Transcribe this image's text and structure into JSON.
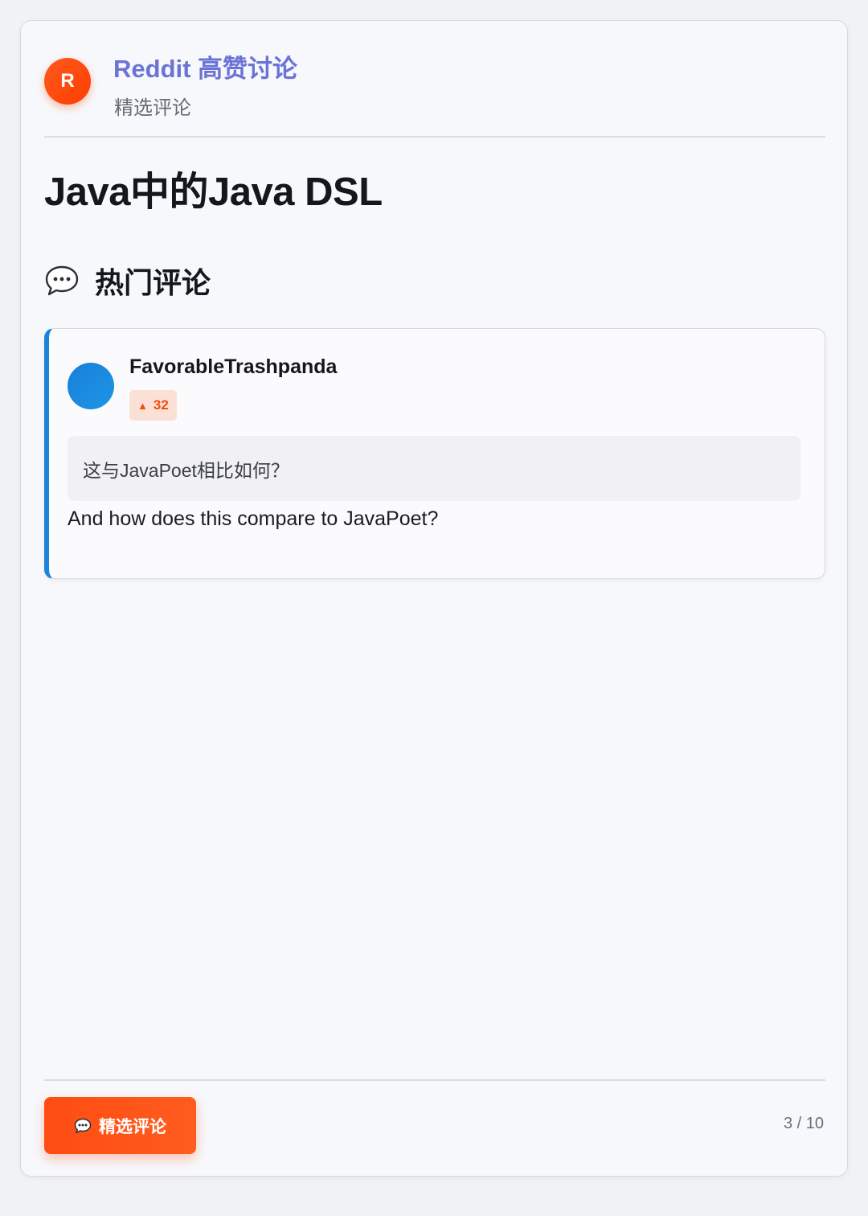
{
  "header": {
    "logo_letter": "R",
    "title": "Reddit 高赞讨论",
    "subtitle": "精选评论"
  },
  "post": {
    "title": "Java中的Java DSL"
  },
  "section": {
    "icon": "speech-bubble-icon",
    "title": "热门评论"
  },
  "comment": {
    "author": "FavorableTrashpanda",
    "votes_arrow": "▲",
    "votes": "32",
    "translated_text": "这与JavaPoet相比如何？",
    "original_text": "And how does this compare to JavaPoet?",
    "accent_color": "#1a84dc"
  },
  "footer": {
    "button_icon": "speech-bubble-icon",
    "button_label": "精选评论",
    "pagination": "3 / 10"
  },
  "colors": {
    "brand": "#ff4500",
    "title_accent": "#6b73d6",
    "background": "#f7f8fb"
  }
}
